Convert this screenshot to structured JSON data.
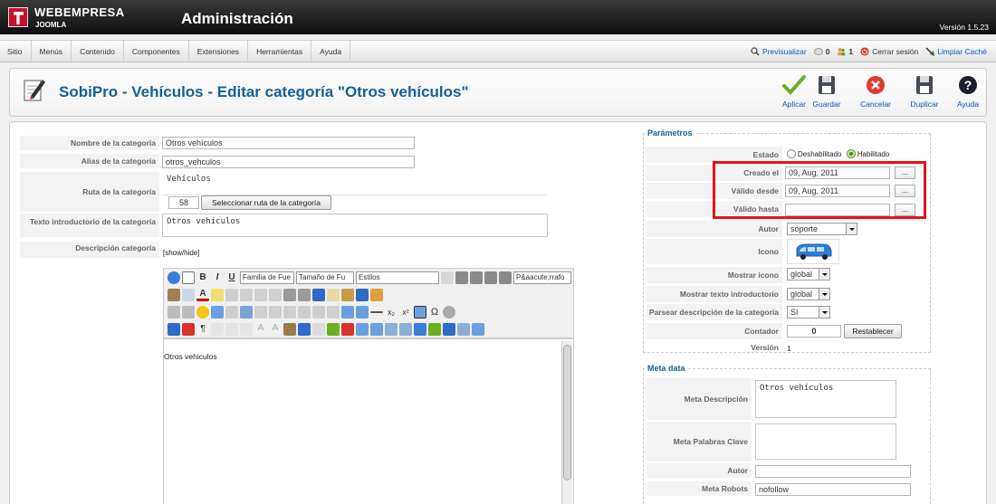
{
  "header": {
    "brand_line1": "WEBEMPRESA",
    "brand_line2": "JOOMLA",
    "title": "Administración",
    "version": "Versión 1.5.23"
  },
  "menu": [
    "Sitio",
    "Menús",
    "Contenido",
    "Componentes",
    "Extensiones",
    "Herramientas",
    "Ayuda"
  ],
  "status": {
    "preview": "Previsualizar",
    "messages": "0",
    "users": "1",
    "logout": "Cerrar sesión",
    "clear_cache": "Limpiar Caché"
  },
  "toolbar": {
    "title": "SobiPro - Vehículos - Editar categoría \"Otros vehículos\"",
    "buttons": {
      "apply": "Aplicar",
      "save": "Guardar",
      "cancel": "Cancelar",
      "duplicate": "Duplicar",
      "help": "Ayuda"
    }
  },
  "form": {
    "name_label": "Nombre de la categoría",
    "name_value": "Otros vehículos",
    "alias_label": "Alias de la categoría",
    "alias_value": "otros_vehculos",
    "path_label": "Ruta de la categoría",
    "path_value": "Vehículos",
    "path_id": "58",
    "path_button": "Seleccionar ruta de la categoría",
    "intro_label": "Texto introductorio de la categoría",
    "intro_value": "Otros vehículos",
    "desc_label": "Descripción categoría",
    "show_hide": "[show/hide]",
    "editor_content": "Otros vehiculos",
    "font_family": "Familia de Fue",
    "font_size": "Tamaño de Fu",
    "styles": "Estilos",
    "paragraph": "P&aacute;rrafo"
  },
  "params": {
    "legend": "Parámetros",
    "state_label": "Estado",
    "state_disabled": "Deshabilitado",
    "state_enabled": "Habilitado",
    "created_label": "Creado el",
    "created_value": "09, Aug, 2011",
    "valid_from_label": "Válido desde",
    "valid_from_value": "09, Aug, 2011",
    "valid_to_label": "Válido hasta",
    "valid_to_value": "",
    "dots": "...",
    "author_label": "Autor",
    "author_value": "soporte",
    "icon_label": "Icono",
    "show_icon_label": "Mostrar icono",
    "show_icon_value": "global",
    "show_intro_label": "Mostrar texto introductorio",
    "show_intro_value": "global",
    "parse_desc_label": "Parsear descripción de la categoría",
    "parse_desc_value": "Sí",
    "counter_label": "Contador",
    "counter_value": "0",
    "reset_button": "Restablecer",
    "version_label": "Versión",
    "version_value": "1"
  },
  "meta": {
    "legend": "Meta data",
    "desc_label": "Meta Descripción",
    "desc_value": "Otros vehículos",
    "keys_label": "Meta Palabras Clave",
    "keys_value": "",
    "author_label": "Autor",
    "author_value": "",
    "robots_label": "Meta Robots",
    "robots_value": "nofollow"
  },
  "colors": {
    "title_blue": "#146295",
    "link_blue": "#0b55c4",
    "highlight_red": "#e8121b",
    "enabled_green": "#4c9a2a"
  }
}
